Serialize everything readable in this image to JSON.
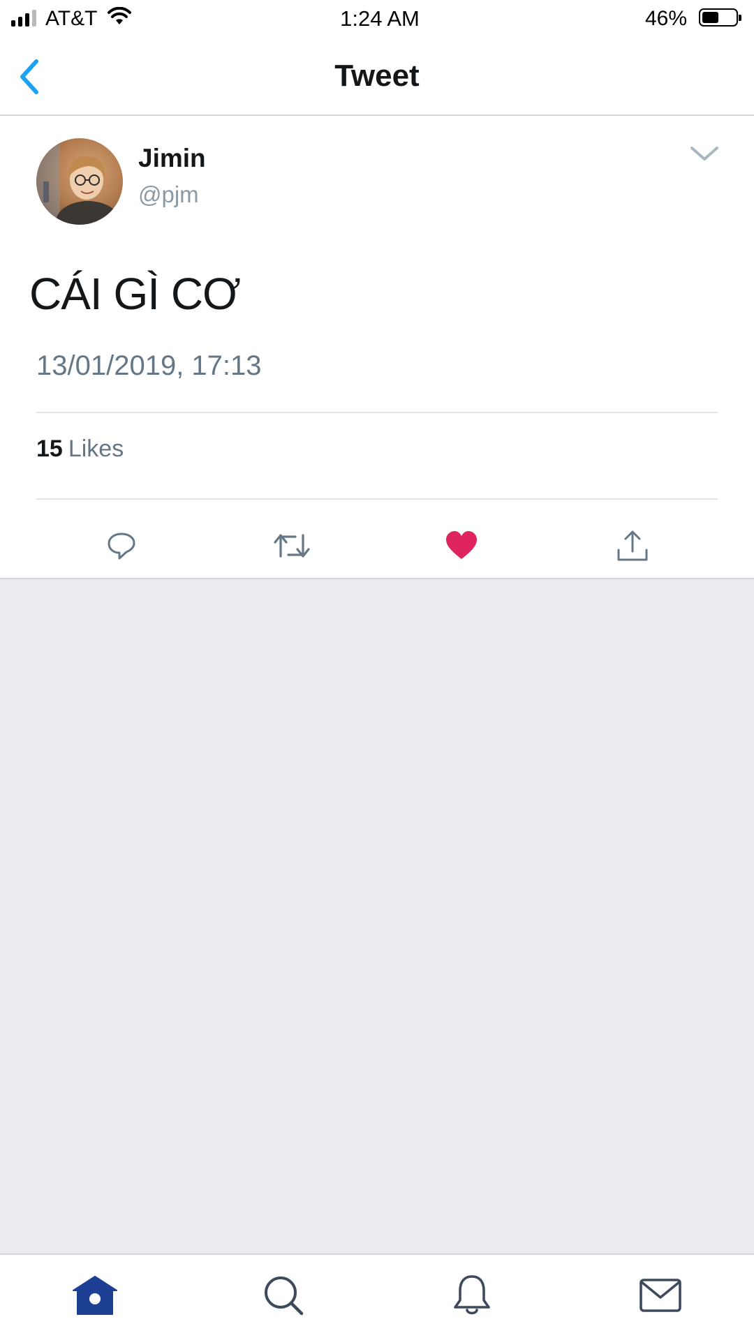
{
  "status_bar": {
    "carrier": "AT&T",
    "time": "1:24 AM",
    "battery_percent": "46%",
    "signal_bars": 3,
    "battery_level": 0.46
  },
  "nav": {
    "title": "Tweet",
    "back_icon": "chevron-left-icon"
  },
  "tweet": {
    "display_name": "Jimin",
    "handle": "@pjm",
    "text": "CÁI GÌ CƠ",
    "timestamp": "13/01/2019, 17:13",
    "likes_count": "15",
    "likes_label": "Likes",
    "liked": true
  },
  "actions": {
    "reply_icon": "reply-icon",
    "retweet_icon": "retweet-icon",
    "like_icon": "heart-icon",
    "share_icon": "share-icon"
  },
  "tab_bar": {
    "active": "home",
    "items": [
      "home-icon",
      "search-icon",
      "bell-icon",
      "envelope-icon"
    ]
  },
  "colors": {
    "accent": "#1da1f2",
    "like_red": "#e0245e",
    "tab_active": "#1c3f94",
    "tab_inactive": "#3e4a5c",
    "background": "#ebebf1"
  }
}
